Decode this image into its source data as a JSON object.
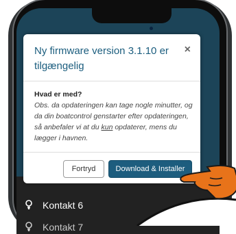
{
  "modal": {
    "title": "Ny firmware version 3.1.10 er tilgængelig",
    "close_label": "×",
    "body_heading": "Hvad er med?",
    "body_text_before": "Obs. da opdateringen kan tage nogle minutter, og da din boatcontrol genstarter efter opdateringen, så anbefaler vi at du ",
    "body_text_underlined": "kun",
    "body_text_after": " opdaterer, mens du lægger i havnen.",
    "cancel_label": "Fortryd",
    "confirm_label": "Download & Installer"
  },
  "list": {
    "items": [
      {
        "label": "Kontakt 6",
        "icon": "lightbulb-icon"
      },
      {
        "label": "Kontakt 7",
        "icon": "lightbulb-icon"
      }
    ]
  },
  "colors": {
    "primary": "#1d5d7e",
    "title": "#1b5d7e",
    "hand": "#e8731a",
    "list_bg": "#222222"
  }
}
